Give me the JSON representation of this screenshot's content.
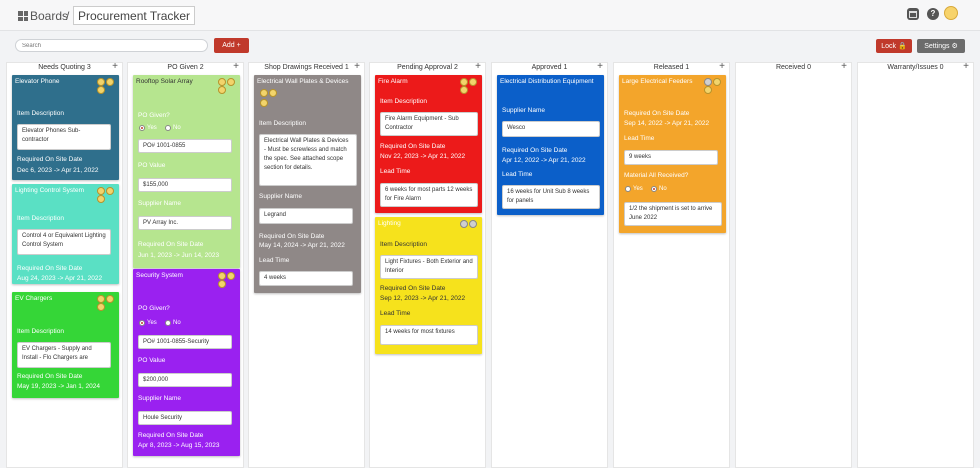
{
  "header": {
    "boards_label": "Boards",
    "separator": "/",
    "title": "Procurement Tracker"
  },
  "toolbar": {
    "search_placeholder": "Search",
    "add_label": "Add +",
    "lock_label": "Lock 🔒",
    "settings_label": "Settings ⚙"
  },
  "columns": [
    {
      "title": "Needs Quoting 3"
    },
    {
      "title": "PO Given 2"
    },
    {
      "title": "Shop Drawings Received 1"
    },
    {
      "title": "Pending Approval 2"
    },
    {
      "title": "Approved 1"
    },
    {
      "title": "Released 1"
    },
    {
      "title": "Received 0"
    },
    {
      "title": "Warranty/Issues 0"
    }
  ],
  "plus": "+",
  "labels": {
    "item_description": "Item Description",
    "required": "Required On Site Date",
    "po_given": "PO Given?",
    "po_value": "PO Value",
    "supplier": "Supplier Name",
    "lead_time": "Lead Time",
    "material": "Material All Received?",
    "yes": "Yes",
    "no": "No"
  },
  "cards": {
    "elevator": {
      "title": "Elevator Phone",
      "desc": "Elevator Phones Sub-contractor",
      "date": "Dec 6, 2023 -> Apr 21, 2022",
      "color": "#2f6f8c"
    },
    "lighting_control": {
      "title": "Lighting Control System",
      "desc": "Control 4 or Equivalent Lighting Control System",
      "date": "Aug 24, 2023 -> Apr 21, 2022",
      "color": "#5ae0c4"
    },
    "ev": {
      "title": "EV Chargers",
      "desc": "EV Chargers - Supply and Install - Flo Chargers are",
      "date": "May 19, 2023 -> Jan 1, 2024",
      "color": "#35d637"
    },
    "solar": {
      "title": "Rooftop Solar Array",
      "po": "PO# 1001-0855",
      "value": "$155,000",
      "supplier": "PV Array Inc.",
      "date": "Jun 1, 2023 -> Jun 14, 2023",
      "color": "#b6e58f"
    },
    "security": {
      "title": "Security System",
      "po": "PO# 1001-0855-Security",
      "value": "$200,000",
      "supplier": "Houle Security",
      "date": "Apr 8, 2023 -> Aug 15, 2023",
      "color": "#9a21f0"
    },
    "wallplates": {
      "title": "Electrical Wall Plates & Devices",
      "desc": "Electrical Wall Plates & Devices - Must be screwless and match the spec. See attached scope section for details.",
      "supplier": "Legrand",
      "date": "May 14, 2024 -> Apr 21, 2022",
      "lead": "4 weeks",
      "color": "#8f8887"
    },
    "fire": {
      "title": "Fire Alarm",
      "desc": "Fire Alarm Equipment - Sub Contractor",
      "date": "Nov 22, 2023 -> Apr 21, 2022",
      "lead": "6 weeks for most parts 12 weeks for Fire Alarm",
      "color": "#ec1a1a"
    },
    "lighting": {
      "title": "Lighting",
      "desc": "Light Fixtures - Both Exterior and Interior",
      "date": "Sep 12, 2023 -> Apr 21, 2022",
      "lead": "14 weeks for most fixtures",
      "color": "#f6e21c"
    },
    "distribution": {
      "title": "Electrical Distribution Equipment",
      "supplier": "Wesco",
      "date": "Apr 12, 2022 -> Apr 21, 2022",
      "lead": "16 weeks for Unit Sub 8 weeks for panels",
      "color": "#0b5fc9"
    },
    "feeders": {
      "title": "Large Electrical Feeders",
      "date": "Sep 14, 2022 -> Apr 21, 2022",
      "lead": "9 weeks",
      "note": "1/2 the shipment is set to arrive June 2022",
      "color": "#f3a52b"
    }
  }
}
